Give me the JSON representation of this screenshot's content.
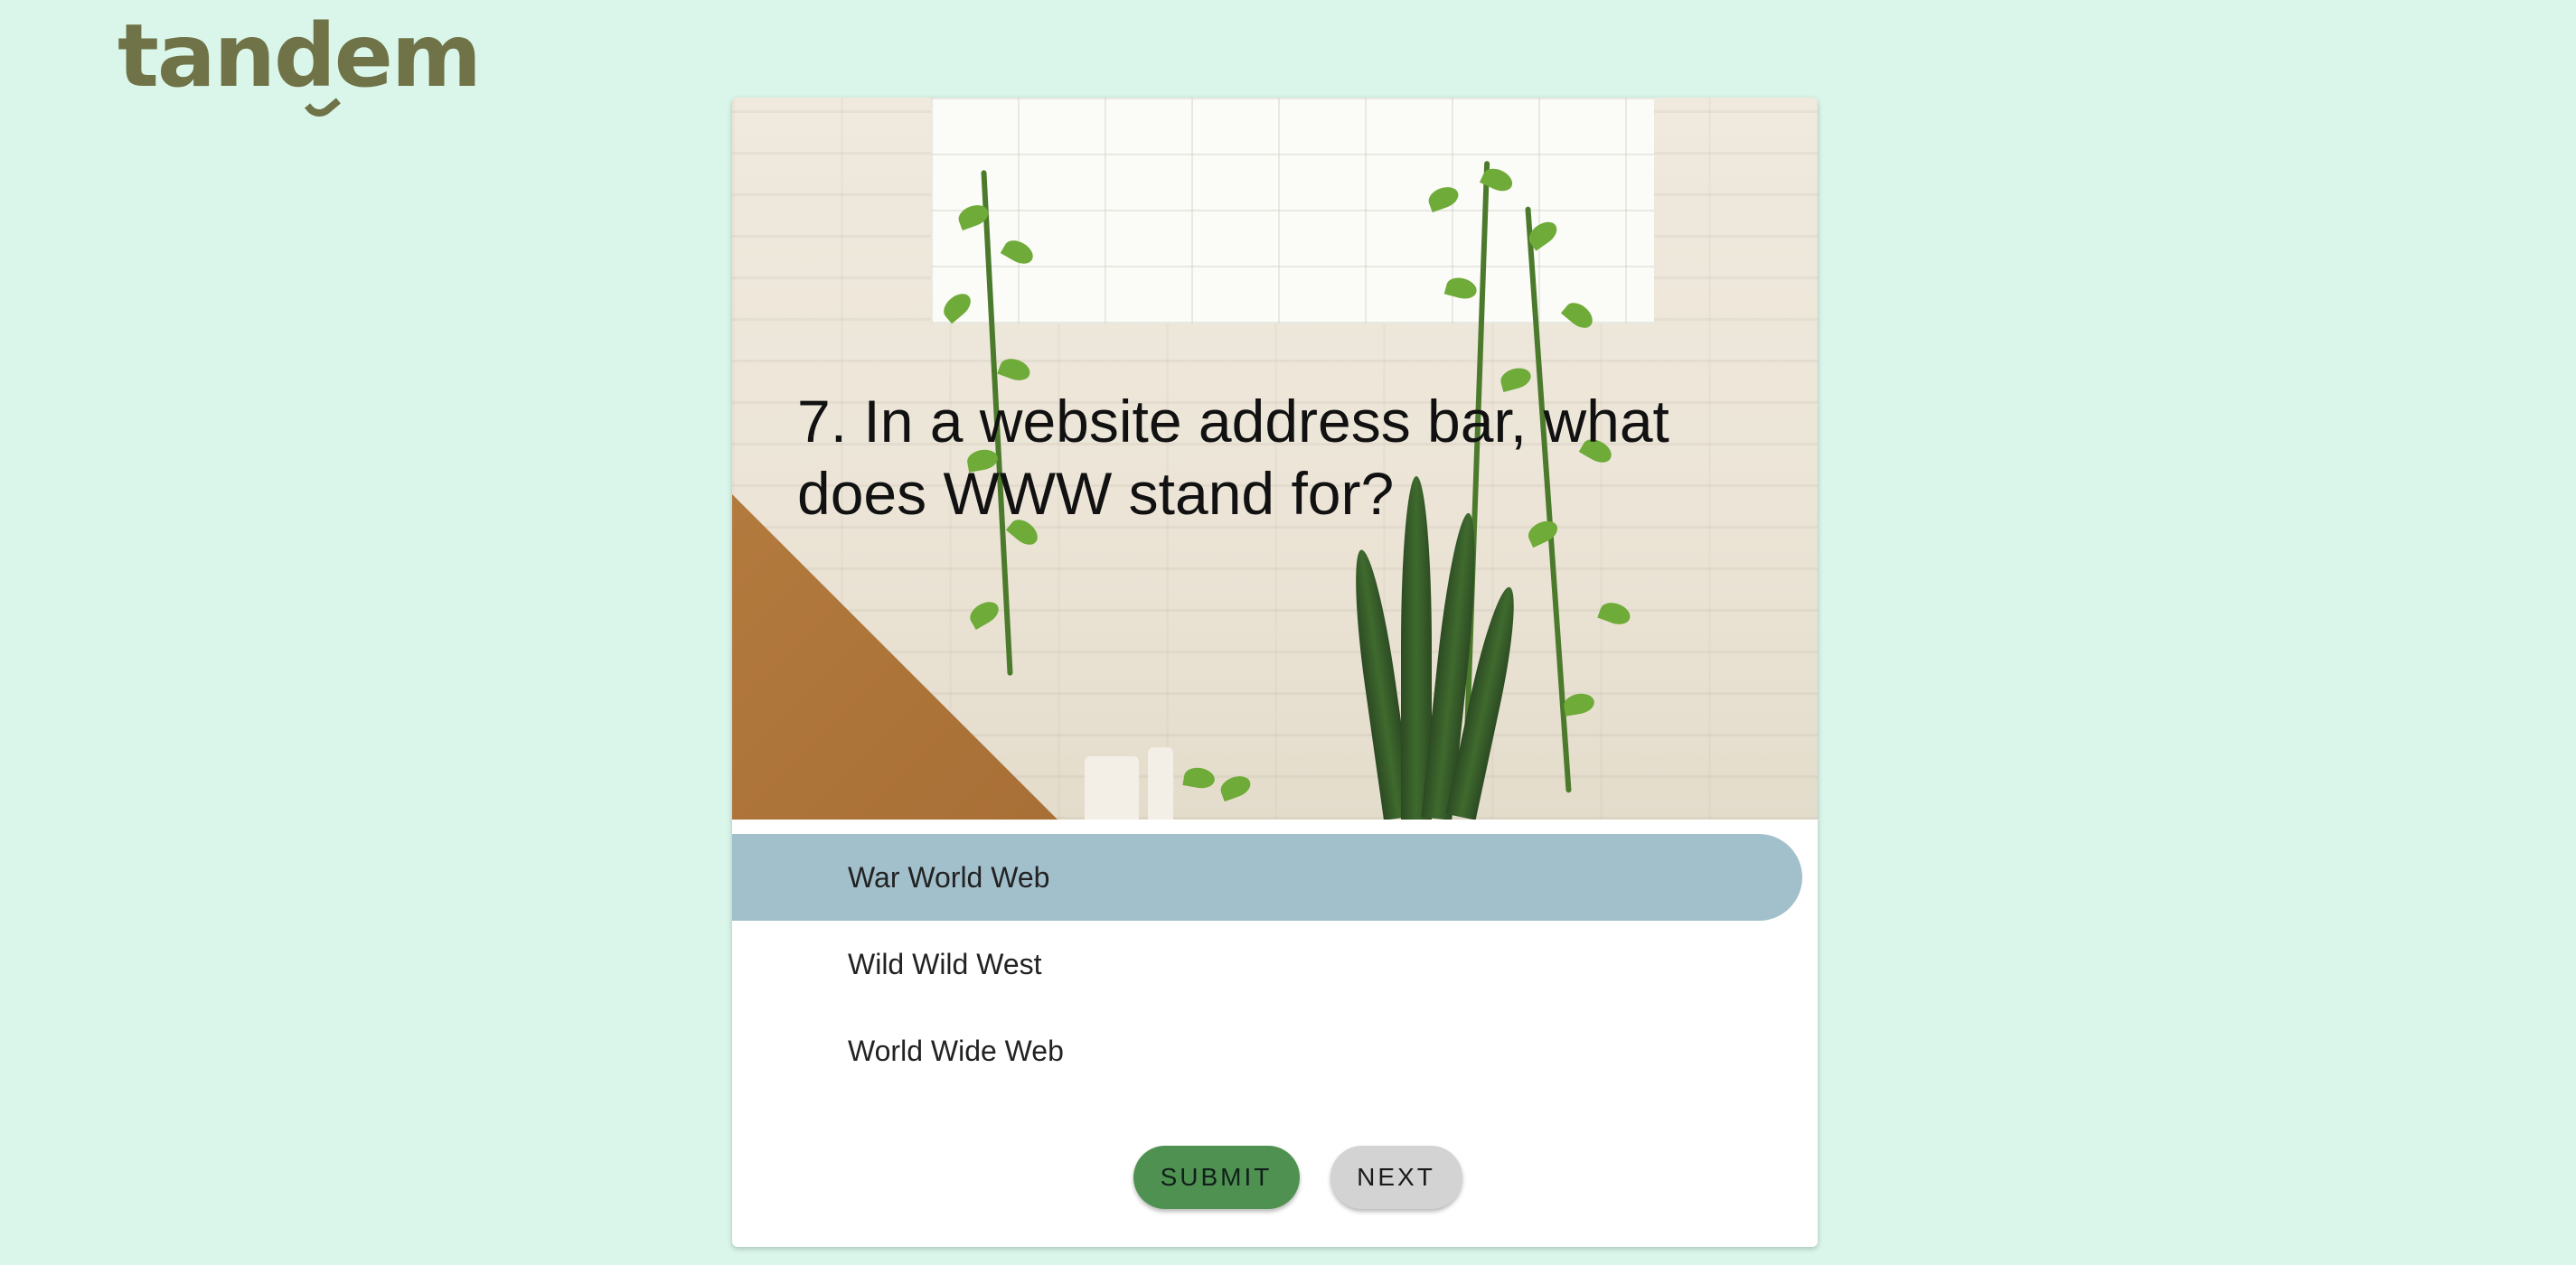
{
  "logo": {
    "text": "tandem"
  },
  "quiz": {
    "question": "7. In a website address bar, what does WWW stand for?",
    "options": [
      {
        "label": "War World Web",
        "selected": true
      },
      {
        "label": "Wild Wild West",
        "selected": false
      },
      {
        "label": "World Wide Web",
        "selected": false
      }
    ],
    "submit_label": "SUBMIT",
    "next_label": "NEXT"
  },
  "colors": {
    "page_background": "#daf5e9",
    "logo": "#6f7347",
    "selected_option": "#a2c0cc",
    "submit_button": "#4f9150",
    "next_button": "#d3d3d3"
  }
}
